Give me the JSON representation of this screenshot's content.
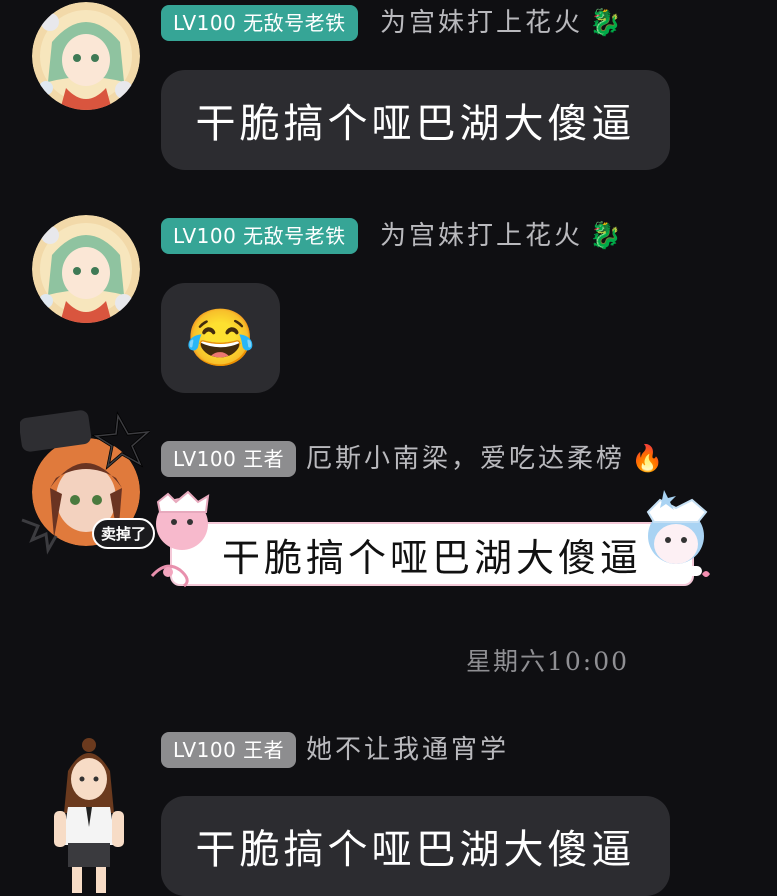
{
  "messages": [
    {
      "badge": "LV100 无敌号老铁",
      "nickname": "为宫妹打上花火",
      "nickname_emoji": "🐉",
      "content": "干脆搞个哑巴湖大傻逼"
    },
    {
      "badge": "LV100 无敌号老铁",
      "nickname": "为宫妹打上花火",
      "nickname_emoji": "🐉",
      "content": "😂"
    },
    {
      "badge": "LV100 王者",
      "nickname": "厄斯小南梁，爱吃达柔榜",
      "nickname_emoji": "🔥",
      "avatar_tag": "卖掉了",
      "content": "干脆搞个哑巴湖大傻逼"
    },
    {
      "badge": "LV100 王者",
      "nickname": "她不让我通宵学",
      "content": "干脆搞个哑巴湖大傻逼"
    }
  ],
  "timestamp": "星期六10:00",
  "colors": {
    "background": "#0f0f12",
    "bubble": "#2c2c30",
    "badge_teal": "#36a596",
    "badge_gray": "#8d8d8f",
    "nickname": "#b9b9bd"
  }
}
